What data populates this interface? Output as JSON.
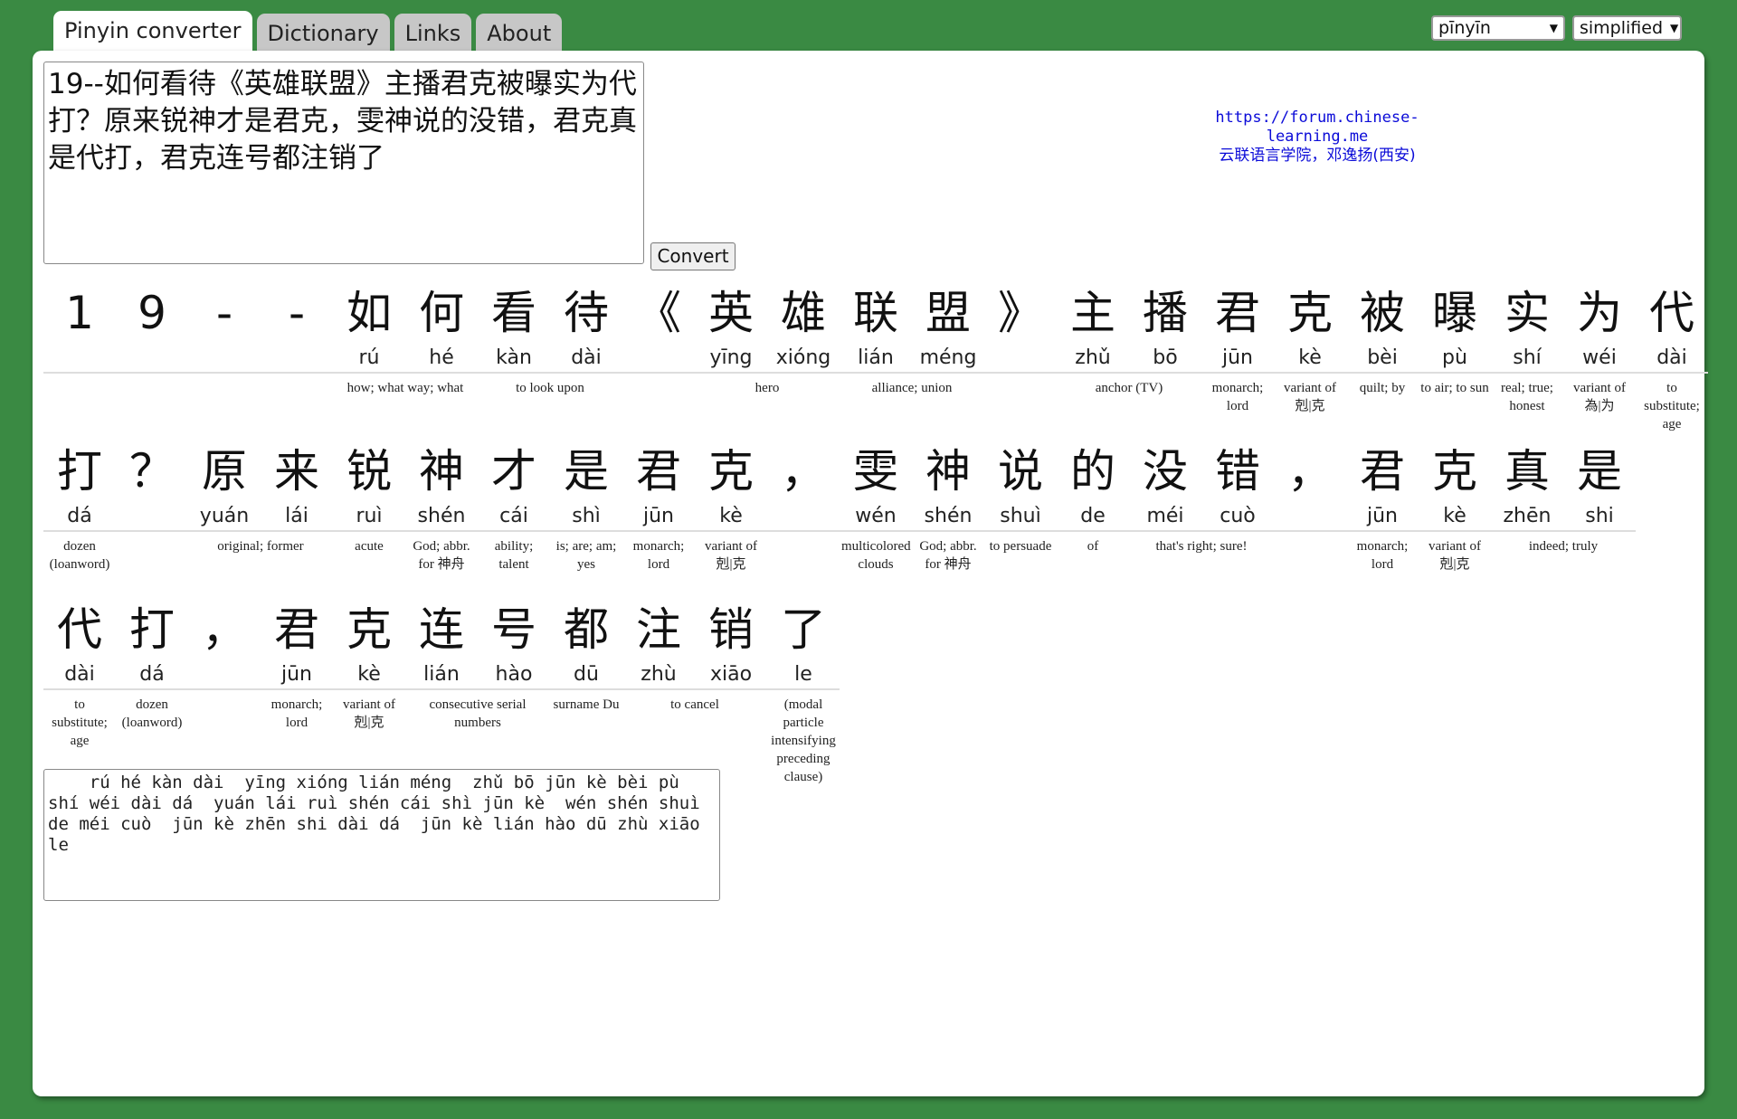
{
  "tabs": [
    {
      "label": "Pinyin converter"
    },
    {
      "label": "Dictionary"
    },
    {
      "label": "Links"
    },
    {
      "label": "About"
    }
  ],
  "options": {
    "tone_style": "pīnyīn",
    "script": "simplified"
  },
  "input_text": "19--如何看待《英雄联盟》主播君克被曝实为代打？原来锐神才是君克，雯神说的没错，君克真是代打，君克连号都注销了",
  "convert_label": "Convert",
  "credit": {
    "url": "https://forum.chinese-learning.me",
    "org": "云联语言学院，邓逸扬(西安)"
  },
  "rows": [
    [
      {
        "ch": "1",
        "py": "",
        "def": ""
      },
      {
        "ch": "9",
        "py": "",
        "def": ""
      },
      {
        "ch": "-",
        "py": "",
        "def": ""
      },
      {
        "ch": "-",
        "py": "",
        "def": ""
      },
      {
        "ch": "如",
        "py": "rú",
        "def": "how; what way; what",
        "span": 2
      },
      {
        "ch": "何",
        "py": "hé",
        "def": ""
      },
      {
        "ch": "看",
        "py": "kàn",
        "def": "to look upon",
        "span": 2
      },
      {
        "ch": "待",
        "py": "dài",
        "def": ""
      },
      {
        "ch": "《",
        "py": "",
        "def": ""
      },
      {
        "ch": "英",
        "py": "yīng",
        "def": "hero",
        "span": 2
      },
      {
        "ch": "雄",
        "py": "xióng",
        "def": ""
      },
      {
        "ch": "联",
        "py": "lián",
        "def": "alliance; union",
        "span": 2
      },
      {
        "ch": "盟",
        "py": "méng",
        "def": ""
      },
      {
        "ch": "》",
        "py": "",
        "def": ""
      },
      {
        "ch": "主",
        "py": "zhǔ",
        "def": "anchor (TV)",
        "span": 2
      },
      {
        "ch": "播",
        "py": "bō",
        "def": ""
      },
      {
        "ch": "君",
        "py": "jūn",
        "def": "monarch; lord"
      },
      {
        "ch": "克",
        "py": "kè",
        "def": "variant of 剋|克"
      },
      {
        "ch": "被",
        "py": "bèi",
        "def": "quilt; by"
      },
      {
        "ch": "曝",
        "py": "pù",
        "def": "to air; to sun"
      },
      {
        "ch": "实",
        "py": "shí",
        "def": "real; true; honest"
      },
      {
        "ch": "为",
        "py": "wéi",
        "def": "variant of 為|为"
      },
      {
        "ch": "代",
        "py": "dài",
        "def": "to substitute; age"
      }
    ],
    [
      {
        "ch": "打",
        "py": "dá",
        "def": "dozen (loanword)"
      },
      {
        "ch": "？",
        "py": "",
        "def": ""
      },
      {
        "ch": "原",
        "py": "yuán",
        "def": "original; former",
        "span": 2
      },
      {
        "ch": "来",
        "py": "lái",
        "def": ""
      },
      {
        "ch": "锐",
        "py": "ruì",
        "def": "acute"
      },
      {
        "ch": "神",
        "py": "shén",
        "def": "God; abbr. for 神舟"
      },
      {
        "ch": "才",
        "py": "cái",
        "def": "ability; talent"
      },
      {
        "ch": "是",
        "py": "shì",
        "def": "is; are; am; yes"
      },
      {
        "ch": "君",
        "py": "jūn",
        "def": "monarch; lord"
      },
      {
        "ch": "克",
        "py": "kè",
        "def": "variant of 剋|克"
      },
      {
        "ch": "，",
        "py": "",
        "def": ""
      },
      {
        "ch": "雯",
        "py": "wén",
        "def": "multicolored clouds"
      },
      {
        "ch": "神",
        "py": "shén",
        "def": "God; abbr. for 神舟"
      },
      {
        "ch": "说",
        "py": "shuì",
        "def": "to persuade"
      },
      {
        "ch": "的",
        "py": "de",
        "def": "of"
      },
      {
        "ch": "没",
        "py": "méi",
        "def": "that's right; sure!",
        "span": 2
      },
      {
        "ch": "错",
        "py": "cuò",
        "def": ""
      },
      {
        "ch": "，",
        "py": "",
        "def": ""
      },
      {
        "ch": "君",
        "py": "jūn",
        "def": "monarch; lord"
      },
      {
        "ch": "克",
        "py": "kè",
        "def": "variant of 剋|克"
      },
      {
        "ch": "真",
        "py": "zhēn",
        "def": "indeed; truly",
        "span": 2
      },
      {
        "ch": "是",
        "py": "shi",
        "def": ""
      }
    ],
    [
      {
        "ch": "代",
        "py": "dài",
        "def": "to substitute; age"
      },
      {
        "ch": "打",
        "py": "dá",
        "def": "dozen (loanword)"
      },
      {
        "ch": "，",
        "py": "",
        "def": ""
      },
      {
        "ch": "君",
        "py": "jūn",
        "def": "monarch; lord"
      },
      {
        "ch": "克",
        "py": "kè",
        "def": "variant of 剋|克"
      },
      {
        "ch": "连",
        "py": "lián",
        "def": "consecutive serial numbers",
        "span": 2
      },
      {
        "ch": "号",
        "py": "hào",
        "def": ""
      },
      {
        "ch": "都",
        "py": "dū",
        "def": "surname Du"
      },
      {
        "ch": "注",
        "py": "zhù",
        "def": "to cancel",
        "span": 2
      },
      {
        "ch": "销",
        "py": "xiāo",
        "def": ""
      },
      {
        "ch": "了",
        "py": "le",
        "def": "(modal particle intensifying preceding clause)"
      }
    ]
  ],
  "output_text": "    rú hé kàn dài  yīng xióng lián méng  zhǔ bō jūn kè bèi pù shí wéi dài dá  yuán lái ruì shén cái shì jūn kè  wén shén shuì de méi cuò  jūn kè zhēn shi dài dá  jūn kè lián hào dū zhù xiāo le"
}
